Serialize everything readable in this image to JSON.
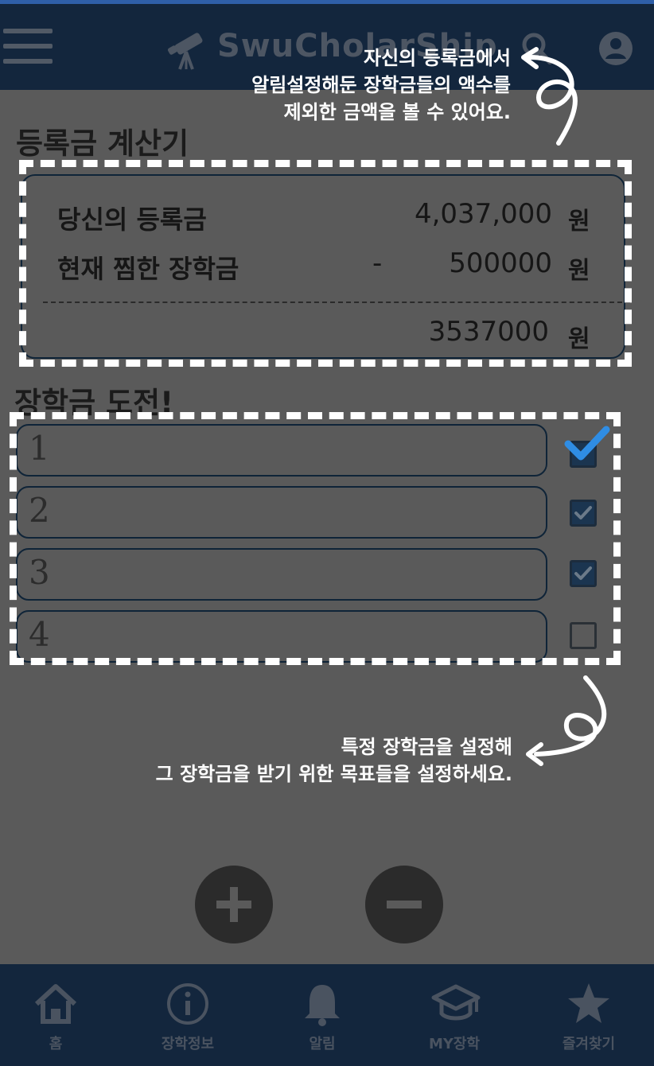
{
  "header": {
    "title": "SwuCholarShip",
    "icons": [
      "menu-icon",
      "telescope-icon",
      "search-icon",
      "account-icon"
    ]
  },
  "calculator": {
    "title": "등록금 계산기",
    "tuition_label": "당신의 등록금",
    "tuition_value": "4,037,000",
    "scholarship_label": "현재 찜한 장학금",
    "minus_sign": "-",
    "scholarship_value": "500000",
    "result_value": "3537000",
    "unit": "원"
  },
  "challenge": {
    "title": "장학금 도전!",
    "goals": [
      {
        "number": "1",
        "value": "",
        "checked": true
      },
      {
        "number": "2",
        "value": "",
        "checked": true
      },
      {
        "number": "3",
        "value": "",
        "checked": true
      },
      {
        "number": "4",
        "value": "",
        "checked": false
      }
    ]
  },
  "annotations": {
    "top_line1": "자신의 등록금에서",
    "top_line2": "알림설정해둔 장학금들의 액수를",
    "top_line3": "제외한 금액을 볼 수 있어요.",
    "bottom_line1": "특정 장학금을 설정해",
    "bottom_line2": "그 장학금을 받기 위한 목표들을 설정하세요."
  },
  "buttons": {
    "add_icon": "plus-icon",
    "remove_icon": "minus-icon"
  },
  "bottom_nav": {
    "items": [
      {
        "label": "홈",
        "icon": "home-icon"
      },
      {
        "label": "장학정보",
        "icon": "info-icon"
      },
      {
        "label": "알림",
        "icon": "bell-icon"
      },
      {
        "label": "MY장학",
        "icon": "graduation-cap-icon"
      },
      {
        "label": "즐겨찾기",
        "icon": "star-icon"
      }
    ]
  },
  "colors": {
    "overlay_background": "#5a5a5a",
    "header_background": "#13263d",
    "accent_check": "#2f8de4",
    "annotation_text": "#ffffff"
  }
}
